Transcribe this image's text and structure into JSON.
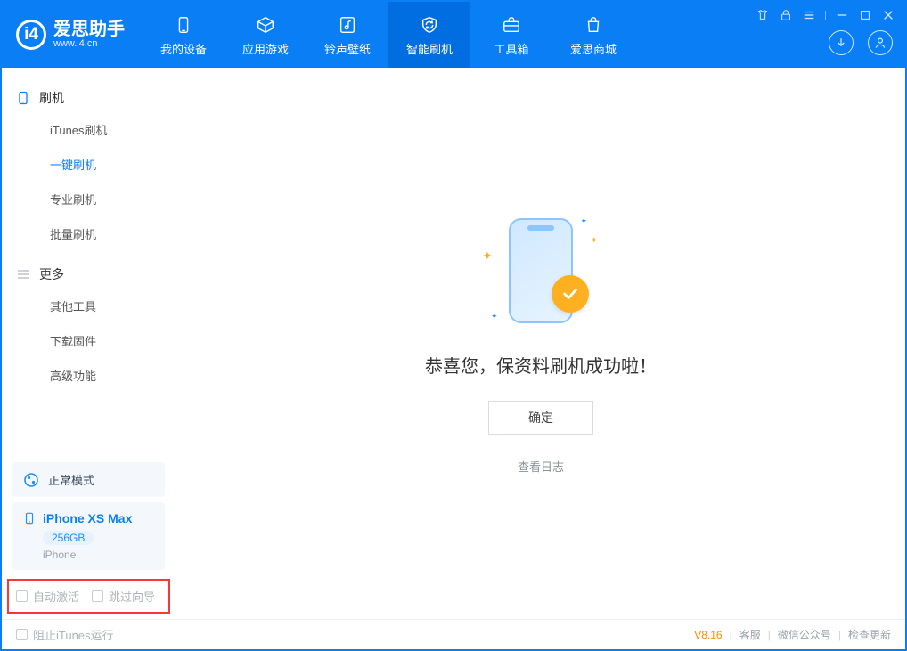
{
  "header": {
    "app_name": "爱思助手",
    "app_url": "www.i4.cn",
    "tabs": [
      {
        "label": "我的设备"
      },
      {
        "label": "应用游戏"
      },
      {
        "label": "铃声壁纸"
      },
      {
        "label": "智能刷机"
      },
      {
        "label": "工具箱"
      },
      {
        "label": "爱思商城"
      }
    ]
  },
  "sidebar": {
    "section1_title": "刷机",
    "items1": [
      {
        "label": "iTunes刷机"
      },
      {
        "label": "一键刷机"
      },
      {
        "label": "专业刷机"
      },
      {
        "label": "批量刷机"
      }
    ],
    "section2_title": "更多",
    "items2": [
      {
        "label": "其他工具"
      },
      {
        "label": "下载固件"
      },
      {
        "label": "高级功能"
      }
    ],
    "mode": "正常模式",
    "device_name": "iPhone XS Max",
    "device_capacity": "256GB",
    "device_type": "iPhone",
    "checkbox1": "自动激活",
    "checkbox2": "跳过向导"
  },
  "main": {
    "success_title": "恭喜您，保资料刷机成功啦！",
    "confirm": "确定",
    "view_log": "查看日志"
  },
  "status": {
    "block_itunes": "阻止iTunes运行",
    "version": "V8.16",
    "link1": "客服",
    "link2": "微信公众号",
    "link3": "检查更新"
  }
}
